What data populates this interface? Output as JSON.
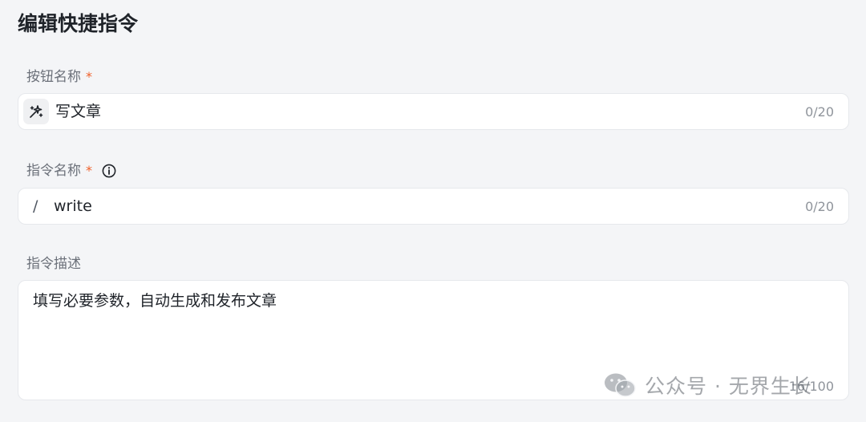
{
  "page_title": "编辑快捷指令",
  "button_name": {
    "label": "按钮名称",
    "required_mark": "*",
    "icon": "magic-sparkle-icon",
    "value": "写文章",
    "counter": "0/20"
  },
  "command_name": {
    "label": "指令名称",
    "required_mark": "*",
    "info_icon": "info-icon",
    "prefix": "/",
    "value": "write",
    "counter": "0/20"
  },
  "command_desc": {
    "label": "指令描述",
    "value": "填写必要参数，自动生成和发布文章",
    "counter": "16/100"
  },
  "watermark": {
    "icon": "wechat-icon",
    "text": "公众号 · 无界生长"
  },
  "colors": {
    "background": "#f4f5f7",
    "required": "#f0602a",
    "field_border": "#e6e8ec"
  }
}
